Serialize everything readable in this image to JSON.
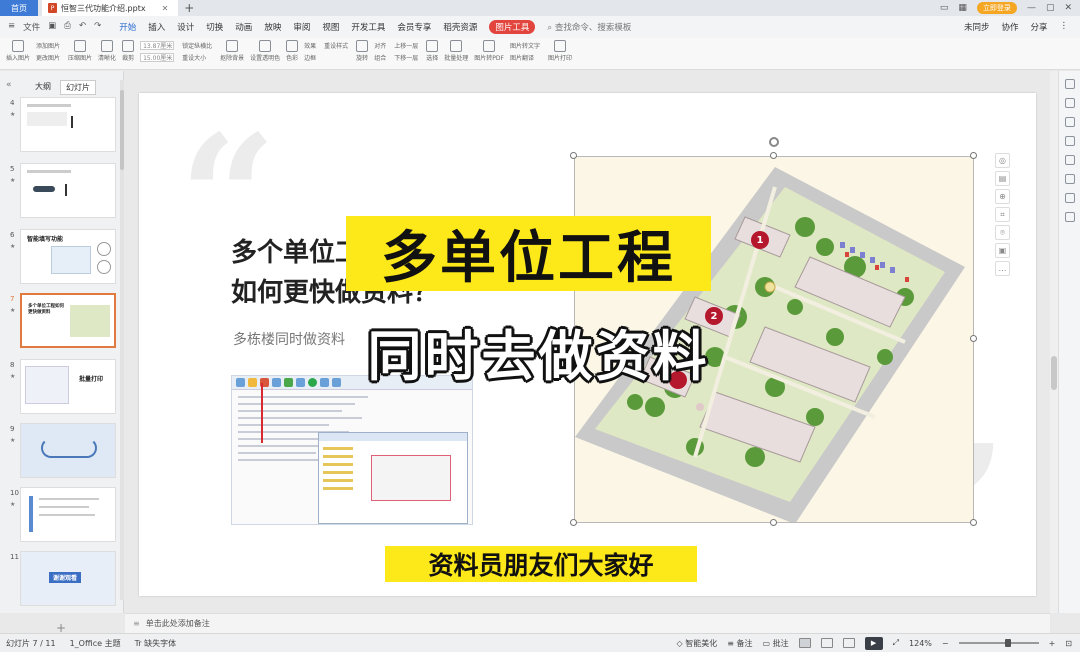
{
  "titlebar": {
    "home": "首页",
    "doc_tab": "恒智三代功能介绍.pptx",
    "login": "立即登录"
  },
  "menubar": {
    "file": "文件",
    "items": [
      "开始",
      "插入",
      "设计",
      "切换",
      "动画",
      "放映",
      "审阅",
      "视图",
      "开发工具",
      "会员专享",
      "稻壳资源"
    ],
    "picture_tools": "图片工具",
    "search": "查找命令、搜索模板",
    "sync": "未同步",
    "collab": "协作",
    "share": "分享"
  },
  "ribbon": {
    "labels": [
      "插入图片",
      "添加图片",
      "更改图片",
      "压缩图片",
      "清晰化",
      "裁剪",
      "13.87厘米",
      "15.00厘米",
      "锁定纵横比",
      "重设大小",
      "抠除背景",
      "设置透明色",
      "色彩",
      "效果",
      "边框",
      "重设样式",
      "旋转",
      "对齐",
      "组合",
      "上移一层",
      "下移一层",
      "选择",
      "批量处理",
      "图片转PDF",
      "图片转文字",
      "图片翻译",
      "图片打印"
    ]
  },
  "left_panel": {
    "tabs": [
      "大纲",
      "幻灯片"
    ],
    "slides": [
      {
        "num": "4",
        "title": "",
        "active": false
      },
      {
        "num": "5",
        "title": "",
        "active": false
      },
      {
        "num": "6",
        "title": "智能填写功能",
        "active": false
      },
      {
        "num": "7",
        "title": "多个单位工程如何更快做资料",
        "active": true
      },
      {
        "num": "8",
        "title": "批量打印",
        "active": false
      },
      {
        "num": "9",
        "title": "",
        "active": false
      },
      {
        "num": "10",
        "title": "",
        "active": false
      },
      {
        "num": "11",
        "title": "谢谢观看",
        "active": false
      }
    ]
  },
  "slide": {
    "title": "多个单位工程\n如何更快做资料？",
    "subtitle": "多栋楼同时做资料",
    "markers": [
      "1",
      "2"
    ]
  },
  "overlay": {
    "banner_top": "多单位工程",
    "banner_bottom": "同时去做资料",
    "caption": "资料员朋友们大家好"
  },
  "notes": {
    "placeholder": "单击此处添加备注"
  },
  "statusbar": {
    "slide_counter": "幻灯片 7 / 11",
    "theme": "1_Office 主题",
    "missing_font": "缺失字体",
    "beautify": "智能美化",
    "notes": "备注",
    "comments": "批注",
    "zoom": "124%"
  },
  "colors": {
    "accent_yellow": "#fde81a",
    "active_tab_red": "#e1453d",
    "home_blue": "#3d7bd6",
    "map_bg": "#fbf6e6"
  }
}
